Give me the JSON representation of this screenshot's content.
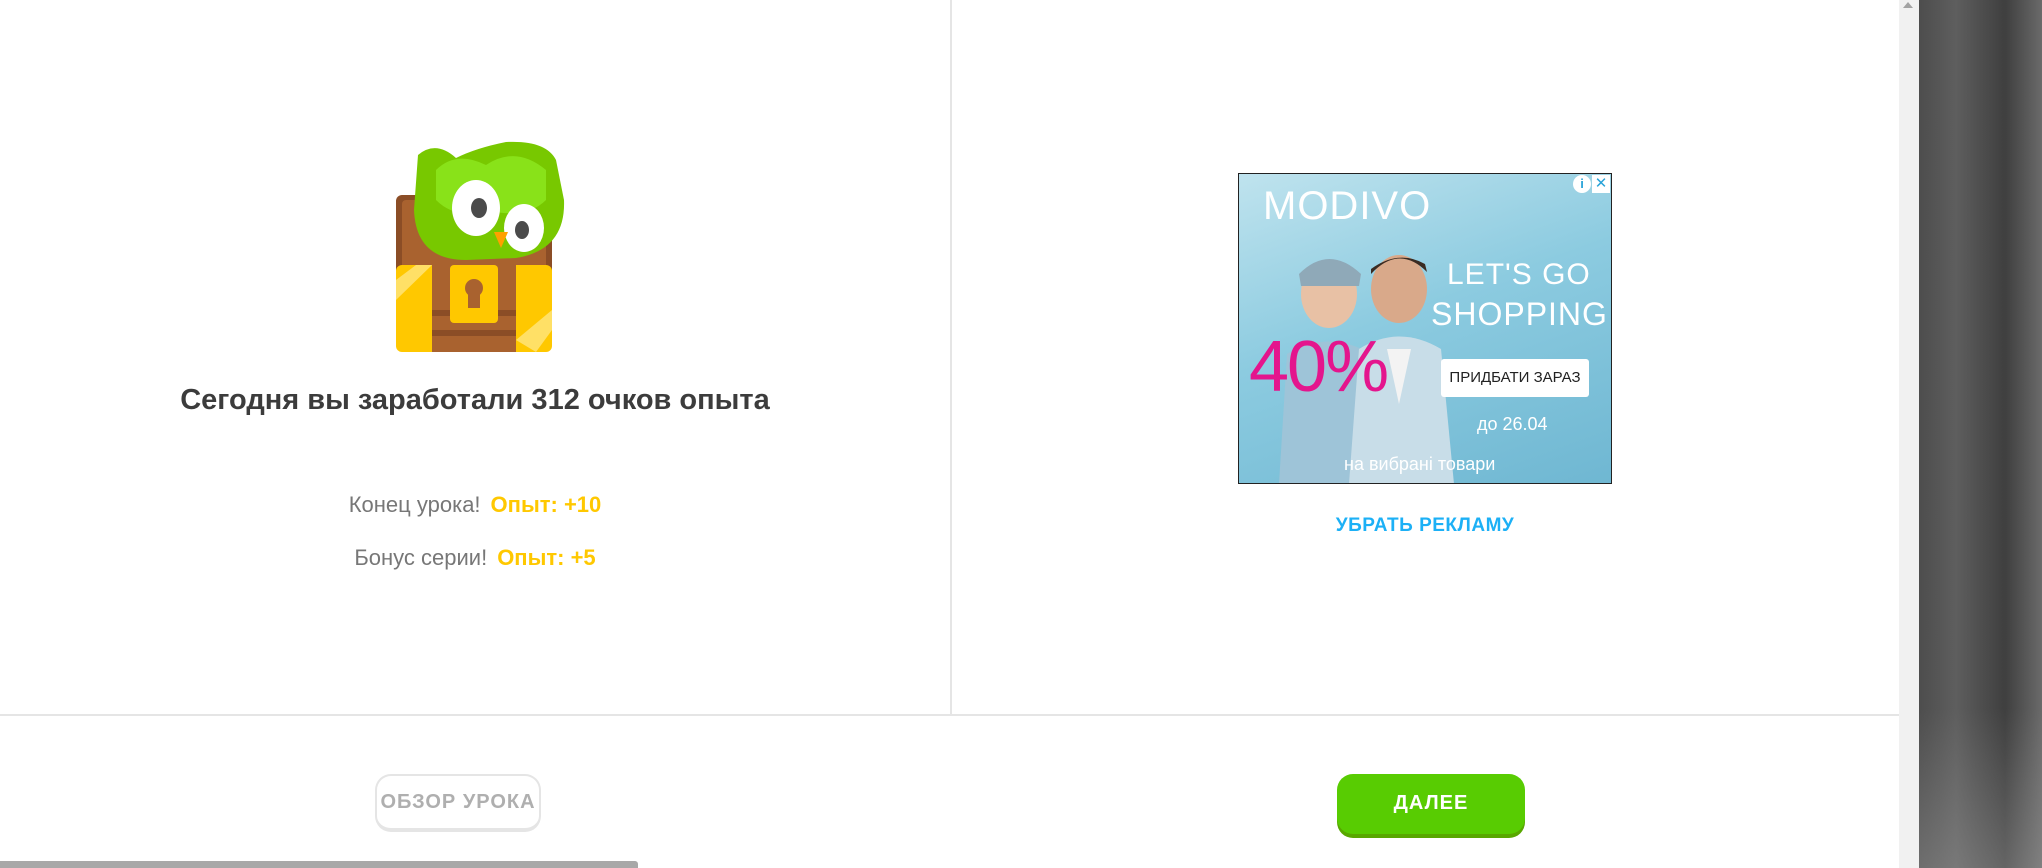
{
  "lesson_complete": {
    "headline": "Сегодня вы заработали 312 очков опыта",
    "rewards": [
      {
        "label": "Конец урока!",
        "xp": "Опыт: +10"
      },
      {
        "label": "Бонус серии!",
        "xp": "Опыт: +5"
      }
    ],
    "mascot_icon": "owl-treasure-chest-icon"
  },
  "ad": {
    "brand": "MODIVO",
    "slogan_line1": "LET'S GO",
    "slogan_line2": "SHOPPING",
    "discount": "40%",
    "cta": "ПРИДБАТИ ЗАРАЗ",
    "date": "до 26.04",
    "note": "на вибрані товари",
    "remove_ads_label": "УБРАТЬ РЕКЛАМУ"
  },
  "footer": {
    "review_label": "ОБЗОР УРОКА",
    "next_label": "ДАЛЕЕ"
  },
  "colors": {
    "accent_green": "#58cc02",
    "xp_gold": "#ffc800",
    "link_blue": "#1cb0f6"
  }
}
